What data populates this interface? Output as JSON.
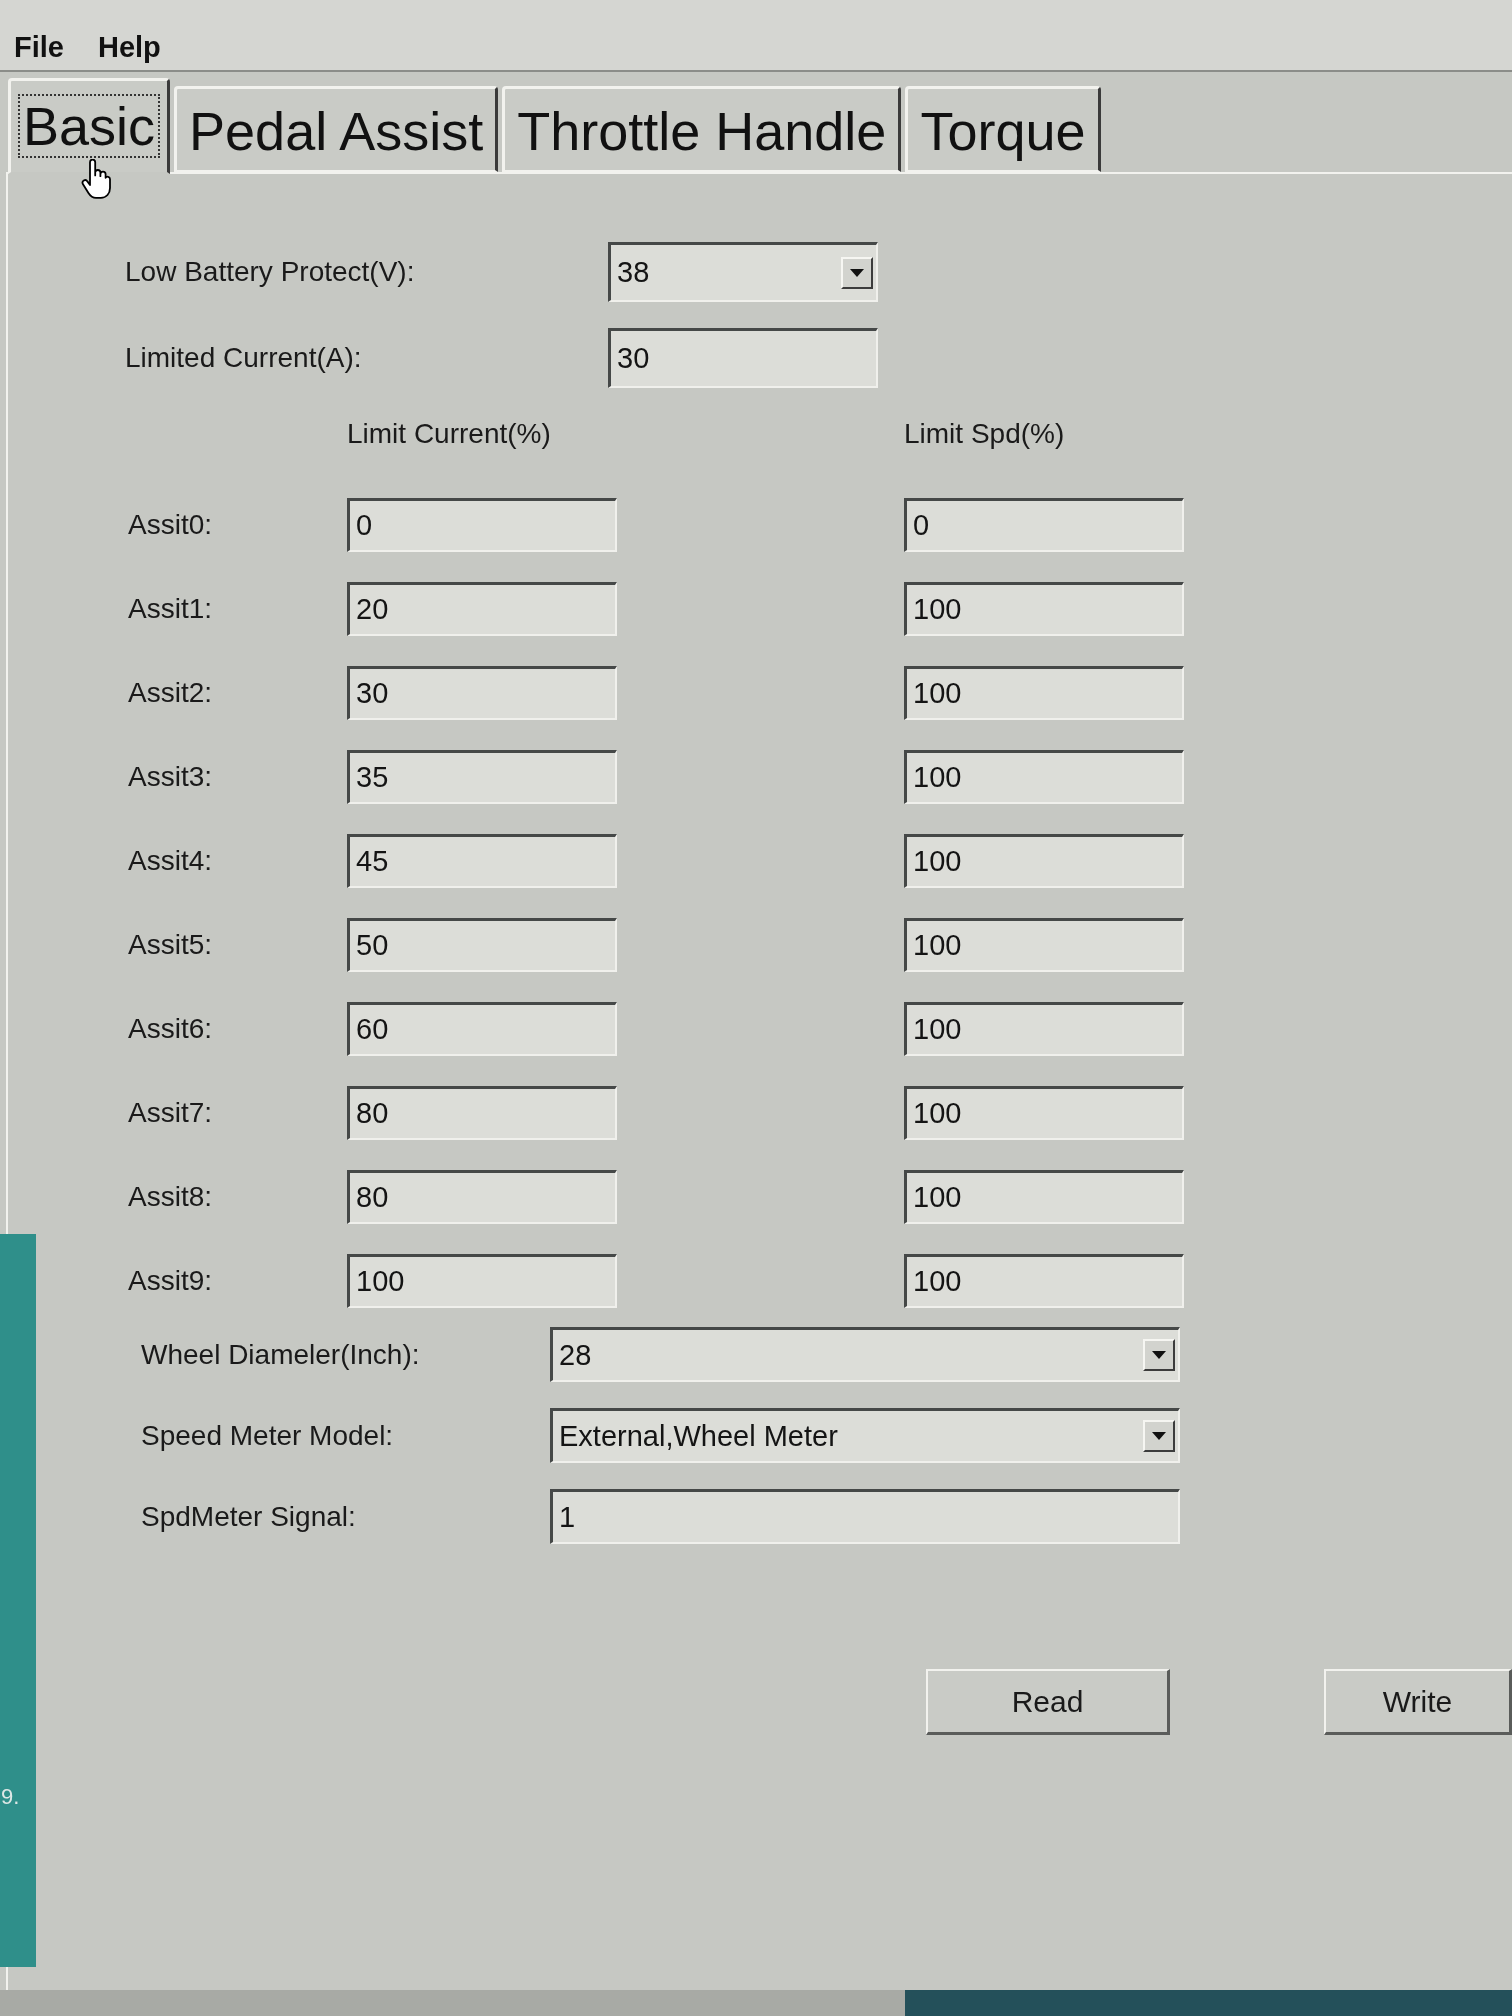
{
  "menu": [
    {
      "label": "File"
    },
    {
      "label": "Help"
    }
  ],
  "tabs": [
    {
      "label": "Basic",
      "selected": true
    },
    {
      "label": "Pedal Assist",
      "selected": false
    },
    {
      "label": "Throttle Handle",
      "selected": false
    },
    {
      "label": "Torque",
      "selected": false
    }
  ],
  "battery_settings": [
    {
      "kind": "dropdown",
      "label": "Low Battery Protect(V):",
      "value": "38"
    },
    {
      "kind": "text",
      "label": "Limited Current(A):",
      "value": "30"
    }
  ],
  "assist_levels": {
    "columns": [
      "Limit Current(%)",
      "Limit Spd(%)"
    ],
    "rows": [
      {
        "label": "Assit0:",
        "limit_current": "0",
        "limit_spd": "0"
      },
      {
        "label": "Assit1:",
        "limit_current": "20",
        "limit_spd": "100"
      },
      {
        "label": "Assit2:",
        "limit_current": "30",
        "limit_spd": "100"
      },
      {
        "label": "Assit3:",
        "limit_current": "35",
        "limit_spd": "100"
      },
      {
        "label": "Assit4:",
        "limit_current": "45",
        "limit_spd": "100"
      },
      {
        "label": "Assit5:",
        "limit_current": "50",
        "limit_spd": "100"
      },
      {
        "label": "Assit6:",
        "limit_current": "60",
        "limit_spd": "100"
      },
      {
        "label": "Assit7:",
        "limit_current": "80",
        "limit_spd": "100"
      },
      {
        "label": "Assit8:",
        "limit_current": "80",
        "limit_spd": "100"
      },
      {
        "label": "Assit9:",
        "limit_current": "100",
        "limit_spd": "100"
      }
    ]
  },
  "speed_settings": [
    {
      "kind": "dropdown",
      "label": "Wheel Diameler(Inch):",
      "value": "28"
    },
    {
      "kind": "dropdown",
      "label": "Speed Meter Model:",
      "value": "External,Wheel Meter"
    },
    {
      "kind": "text",
      "label": "SpdMeter Signal:",
      "value": "1"
    }
  ],
  "buttons": [
    {
      "label": "Read"
    },
    {
      "label": "Write"
    }
  ],
  "desktop_edge": {
    "label": "9."
  }
}
